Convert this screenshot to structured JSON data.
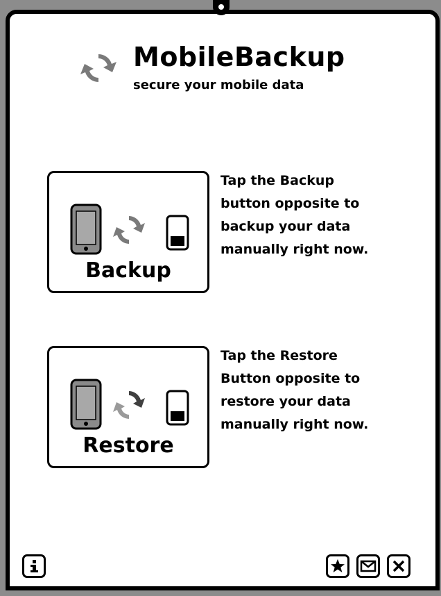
{
  "app": {
    "title": "MobileBackup",
    "subtitle": "secure your mobile data"
  },
  "actions": [
    {
      "label": "Backup",
      "description": [
        "Tap the Backup",
        "button opposite to",
        "backup your data",
        "manually right now."
      ]
    },
    {
      "label": "Restore",
      "description": [
        "Tap the Restore",
        "Button opposite to",
        "restore your data",
        "manually right now."
      ]
    }
  ],
  "footer": {
    "info_icon": "info-icon",
    "right_icons": [
      "star-icon",
      "envelope-icon",
      "close-icon"
    ]
  },
  "colors": {
    "ink": "#000000",
    "sync_gray": "#7a7a7a",
    "device_gray": "#8a8a8a",
    "background": "#ffffff"
  }
}
